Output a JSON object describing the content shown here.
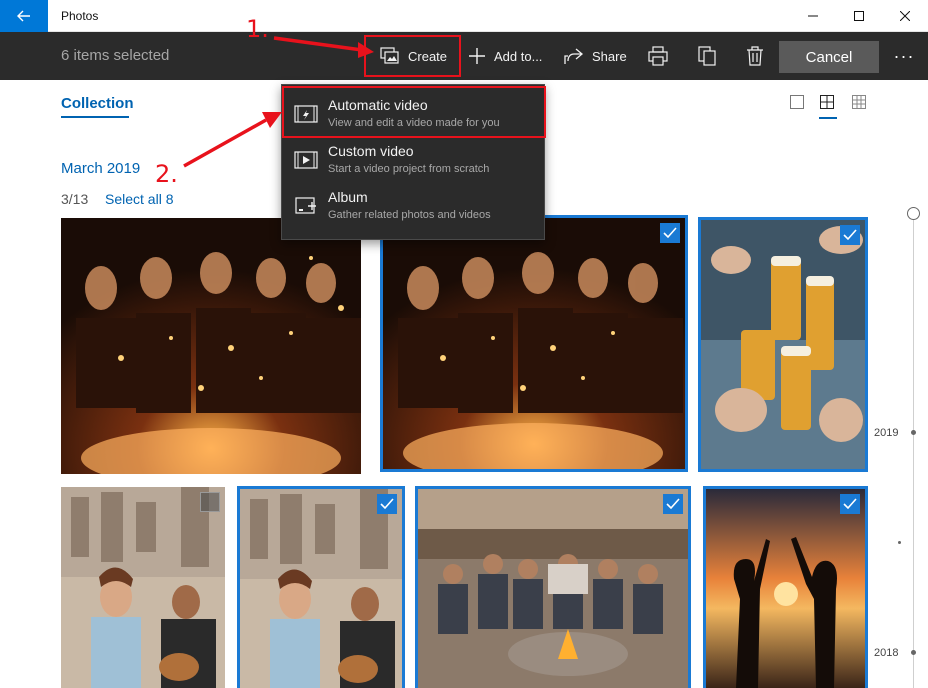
{
  "window": {
    "title": "Photos"
  },
  "cmdbar": {
    "selected": "6 items selected",
    "create": "Create",
    "add_to": "Add to...",
    "share": "Share",
    "cancel": "Cancel",
    "more": "···"
  },
  "nav": {
    "collection": "Collection"
  },
  "group": {
    "month": "March 2019",
    "count": "3/13",
    "select_all": "Select all 8"
  },
  "menu": {
    "items": [
      {
        "title": "Automatic video",
        "subtitle": "View and edit a video made for you",
        "icon": "auto-video-icon"
      },
      {
        "title": "Custom video",
        "subtitle": "Start a video project from scratch",
        "icon": "custom-video-icon"
      },
      {
        "title": "Album",
        "subtitle": "Gather related photos and videos",
        "icon": "album-icon"
      }
    ]
  },
  "timeline": {
    "years": [
      "2019",
      "2018"
    ]
  },
  "annotations": {
    "step1": "1.",
    "step2": "2."
  },
  "photos": [
    {
      "desc": "sparklers-group",
      "selected": false
    },
    {
      "desc": "sparklers-group",
      "selected": true
    },
    {
      "desc": "beer-toast",
      "selected": true
    },
    {
      "desc": "guitar-couple",
      "selected": false
    },
    {
      "desc": "guitar-couple",
      "selected": true
    },
    {
      "desc": "campfire-friends",
      "selected": true
    },
    {
      "desc": "sunset-highfive",
      "selected": true
    }
  ],
  "colors": {
    "accent": "#0078d7",
    "highlight": "#e8121c",
    "cmdbar": "#2b2b2b"
  }
}
